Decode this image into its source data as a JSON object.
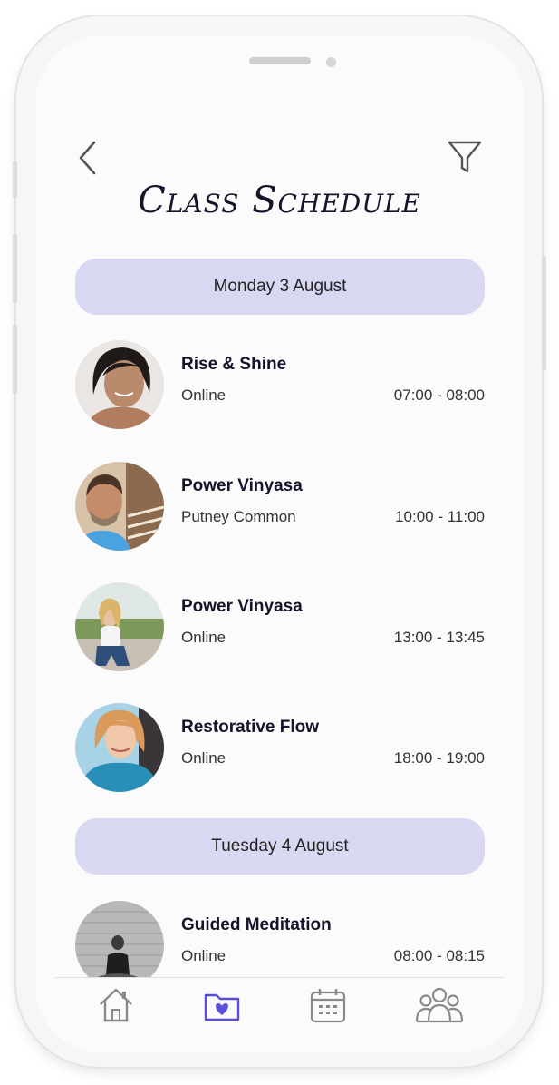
{
  "header": {
    "title": "Class Schedule",
    "back_icon": "chevron-left-icon",
    "filter_icon": "filter-icon"
  },
  "days": [
    {
      "label": "Monday 3 August",
      "classes": [
        {
          "name": "Rise & Shine",
          "location": "Online",
          "time": "07:00 - 08:00"
        },
        {
          "name": "Power Vinyasa",
          "location": "Putney Common",
          "time": "10:00 - 11:00"
        },
        {
          "name": "Power Vinyasa",
          "location": "Online",
          "time": "13:00 - 13:45"
        },
        {
          "name": "Restorative Flow",
          "location": "Online",
          "time": "18:00 - 19:00"
        }
      ]
    },
    {
      "label": "Tuesday 4 August",
      "classes": [
        {
          "name": "Guided Meditation",
          "location": "Online",
          "time": "08:00 - 08:15"
        }
      ]
    }
  ],
  "tabbar": {
    "items": [
      "home-icon",
      "favorites-folder-icon",
      "calendar-icon",
      "community-icon"
    ],
    "active_index": 1
  },
  "colors": {
    "accent": "#5b4fd6",
    "day_header_bg": "#d9d8f3",
    "title": "#15142a",
    "icon_inactive": "#8a8a8a"
  }
}
